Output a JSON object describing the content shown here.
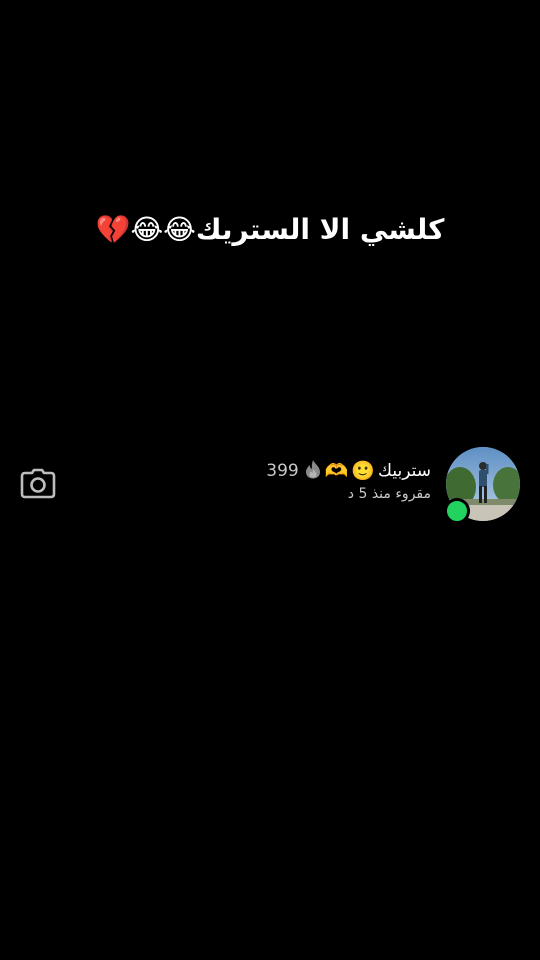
{
  "story_caption": "كلشي الا الستريك😂😂💔",
  "chat": {
    "name": "ستربيك",
    "name_emojis": [
      "🙂",
      "🫶"
    ],
    "streak_icon": "flame-icon",
    "streak_count": "399",
    "status": "مقروء منذ 5 د",
    "online": true,
    "online_color": "#22d360"
  },
  "camera_icon": "camera-icon"
}
